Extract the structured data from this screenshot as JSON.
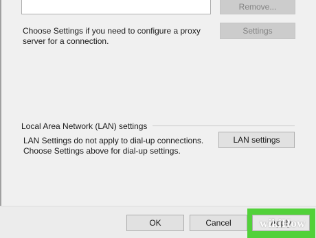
{
  "connections": {
    "remove_label": "Remove...",
    "proxy_text_line1": "Choose Settings if you need to configure a proxy",
    "proxy_text_line2": "server for a connection.",
    "settings_label": "Settings"
  },
  "lan": {
    "group_title": "Local Area Network (LAN) settings",
    "text_line1": "LAN Settings do not apply to dial-up connections.",
    "text_line2": "Choose Settings above for dial-up settings.",
    "lan_settings_label": "LAN settings"
  },
  "footer": {
    "ok_label": "OK",
    "cancel_label": "Cancel",
    "apply_label": "Apply"
  },
  "watermark": "wikiHow",
  "colors": {
    "highlight": "#52d13a",
    "dialog_bg": "#f0f0f0"
  }
}
